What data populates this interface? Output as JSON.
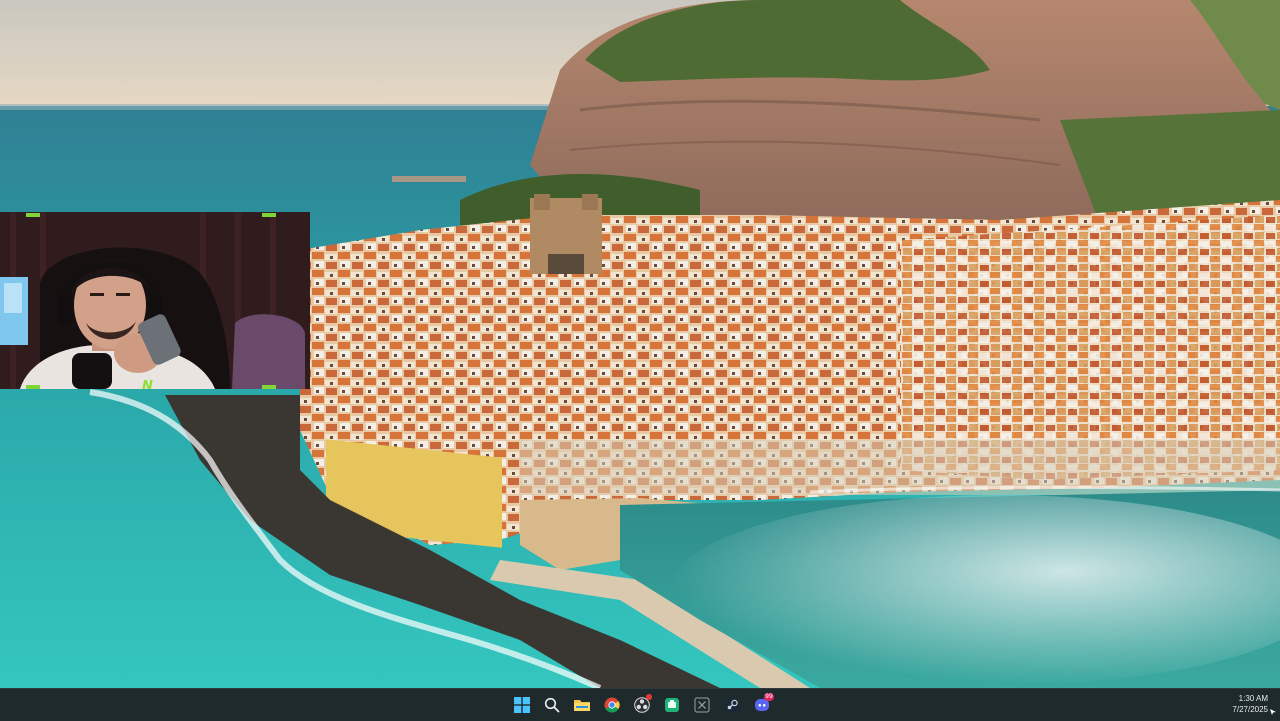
{
  "taskbar": {
    "apps": [
      {
        "name": "start",
        "icon": "windows-logo-icon"
      },
      {
        "name": "search",
        "icon": "search-icon"
      },
      {
        "name": "file-explorer",
        "icon": "folder-icon"
      },
      {
        "name": "chrome",
        "icon": "chrome-icon"
      },
      {
        "name": "obs",
        "icon": "obs-icon",
        "indicator": true
      },
      {
        "name": "app-green",
        "icon": "green-app-icon"
      },
      {
        "name": "xbox",
        "icon": "xbox-icon"
      },
      {
        "name": "steam",
        "icon": "steam-icon"
      },
      {
        "name": "discord",
        "icon": "discord-icon",
        "badge": "99"
      }
    ],
    "clock": {
      "time": "1:30 AM",
      "date": "7/27/2025"
    }
  },
  "webcam": {
    "logo_text": "N"
  },
  "colors": {
    "taskbar_bg": "#1f2a2c",
    "webcam_accent": "#7fd636",
    "sea": "#2bb0b0",
    "rooftops": "#d9843e"
  }
}
